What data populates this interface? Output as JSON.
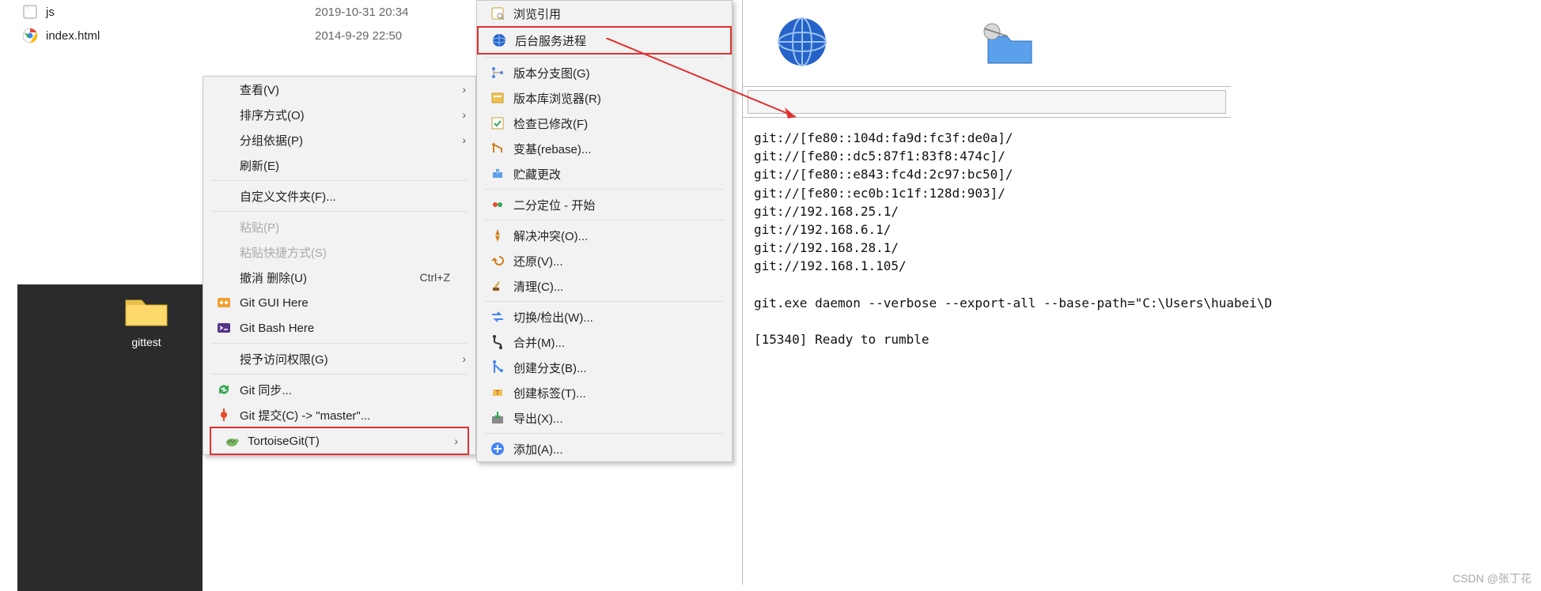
{
  "files": [
    {
      "name": "js",
      "date": "2019-10-31 20:34",
      "icon": "file"
    },
    {
      "name": "index.html",
      "date": "2014-9-29 22:50",
      "icon": "chrome"
    }
  ],
  "folder_label": "gittest",
  "context_menu_1": [
    {
      "label": "查看(V)",
      "type": "sub"
    },
    {
      "label": "排序方式(O)",
      "type": "sub"
    },
    {
      "label": "分组依据(P)",
      "type": "sub"
    },
    {
      "label": "刷新(E)"
    },
    {
      "sep": true
    },
    {
      "label": "自定义文件夹(F)..."
    },
    {
      "sep": true
    },
    {
      "label": "粘贴(P)",
      "disabled": true
    },
    {
      "label": "粘贴快捷方式(S)",
      "disabled": true
    },
    {
      "label": "撤消 删除(U)",
      "shortcut": "Ctrl+Z"
    },
    {
      "label": "Git GUI Here",
      "icon": "git-gui"
    },
    {
      "label": "Git Bash Here",
      "icon": "git-bash"
    },
    {
      "sep": true
    },
    {
      "label": "授予访问权限(G)",
      "type": "sub"
    },
    {
      "sep": true
    },
    {
      "label": "Git 同步...",
      "icon": "git-sync"
    },
    {
      "label": "Git 提交(C) -> \"master\"...",
      "icon": "git-commit"
    },
    {
      "label": "TortoiseGit(T)",
      "type": "sub",
      "icon": "tortoise",
      "hl": true
    }
  ],
  "context_menu_2": [
    {
      "label": "浏览引用",
      "icon": "browse"
    },
    {
      "label": "后台服务进程",
      "icon": "globe",
      "hl": true
    },
    {
      "sep": true
    },
    {
      "label": "版本分支图(G)",
      "icon": "revgraph"
    },
    {
      "label": "版本库浏览器(R)",
      "icon": "repo"
    },
    {
      "label": "检查已修改(F)",
      "icon": "check"
    },
    {
      "label": "变基(rebase)...",
      "icon": "rebase"
    },
    {
      "label": "贮藏更改",
      "icon": "stash"
    },
    {
      "sep": true
    },
    {
      "label": "二分定位 - 开始",
      "icon": "bisect"
    },
    {
      "sep": true
    },
    {
      "label": "解决冲突(O)...",
      "icon": "resolve"
    },
    {
      "label": "还原(V)...",
      "icon": "revert"
    },
    {
      "label": "清理(C)...",
      "icon": "clean"
    },
    {
      "sep": true
    },
    {
      "label": "切换/检出(W)...",
      "icon": "switch"
    },
    {
      "label": "合并(M)...",
      "icon": "merge"
    },
    {
      "label": "创建分支(B)...",
      "icon": "branch"
    },
    {
      "label": "创建标签(T)...",
      "icon": "tag"
    },
    {
      "label": "导出(X)...",
      "icon": "export"
    },
    {
      "sep": true
    },
    {
      "label": "添加(A)...",
      "icon": "add"
    }
  ],
  "terminal_text": "git://[fe80::104d:fa9d:fc3f:de0a]/\ngit://[fe80::dc5:87f1:83f8:474c]/\ngit://[fe80::e843:fc4d:2c97:bc50]/\ngit://[fe80::ec0b:1c1f:128d:903]/\ngit://192.168.25.1/\ngit://192.168.6.1/\ngit://192.168.28.1/\ngit://192.168.1.105/\n\ngit.exe daemon --verbose --export-all --base-path=\"C:\\Users\\huabei\\D\n\n[15340] Ready to rumble",
  "watermark": "CSDN @张丁花"
}
